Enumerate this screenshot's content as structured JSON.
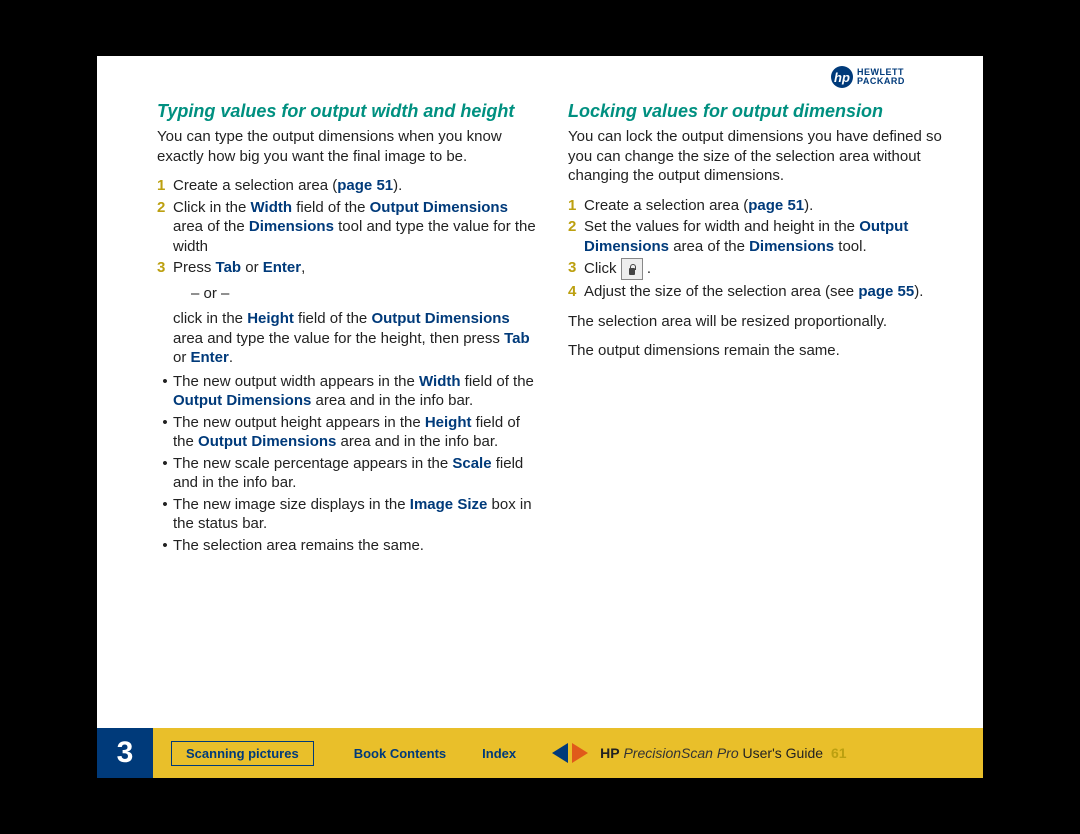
{
  "logo": {
    "line1": "HEWLETT",
    "line2": "PACKARD",
    "glyph": "hp"
  },
  "left": {
    "heading": "Typing values for output width and height",
    "intro": "You can type the output dimensions when you know exactly how big you want the final image to be.",
    "step1_a": "Create a selection area (",
    "step1_link": "page 51",
    "step1_b": ").",
    "step2_a": "Click in the ",
    "step2_width": "Width",
    "step2_b": " field of the ",
    "step2_od": "Output Dimensions",
    "step2_c": " area of the ",
    "step2_dim": "Dimensions",
    "step2_d": " tool and type the value for the width",
    "step3_a": "Press ",
    "step3_tab": "Tab",
    "step3_b": " or ",
    "step3_enter": "Enter",
    "step3_c": ",",
    "or": "– or –",
    "step3_alt_a": "click in the ",
    "step3_alt_h": "Height",
    "step3_alt_b": " field of the ",
    "step3_alt_od": "Output Dimensions",
    "step3_alt_c": " area and type the value for the height, then press ",
    "step3_alt_tab": "Tab",
    "step3_alt_d": " or ",
    "step3_alt_enter": "Enter",
    "step3_alt_e": ".",
    "b1_a": "The new output width appears in the ",
    "b1_w": "Width",
    "b1_b": " field of the ",
    "b1_od": "Output Dimensions",
    "b1_c": " area and in the info bar.",
    "b2_a": "The new output height appears in the ",
    "b2_h": "Height",
    "b2_b": " field of the ",
    "b2_od": "Output Dimensions",
    "b2_c": " area and in the info bar.",
    "b3_a": "The new scale percentage appears in the ",
    "b3_s": "Scale",
    "b3_b": " field and in the info bar.",
    "b4_a": "The new image size displays in the ",
    "b4_is": "Image Size",
    "b4_b": " box in the status bar.",
    "b5": "The selection area remains the same."
  },
  "right": {
    "heading": "Locking values for output dimension",
    "intro": "You can lock the output dimensions you have defined so you can change the size of the selection area without changing the output dimensions.",
    "step1_a": "Create a selection area (",
    "step1_link": "page 51",
    "step1_b": ").",
    "step2_a": "Set the values for width and height in the ",
    "step2_od": "Output Dimensions",
    "step2_b": " area of the ",
    "step2_dim": "Dimensions",
    "step2_c": " tool.",
    "step3_a": "Click ",
    "step3_b": ".",
    "step4_a": "Adjust the size of the selection area (see ",
    "step4_link": "page 55",
    "step4_b": ").",
    "p1": "The selection area will be resized proportionally.",
    "p2": "The output dimensions remain the same."
  },
  "footer": {
    "chapter": "3",
    "section": "Scanning pictures",
    "book": "Book Contents",
    "index": "Index",
    "hp": "HP",
    "product": "PrecisionScan Pro",
    "guide": " User's Guide",
    "page": "61"
  }
}
